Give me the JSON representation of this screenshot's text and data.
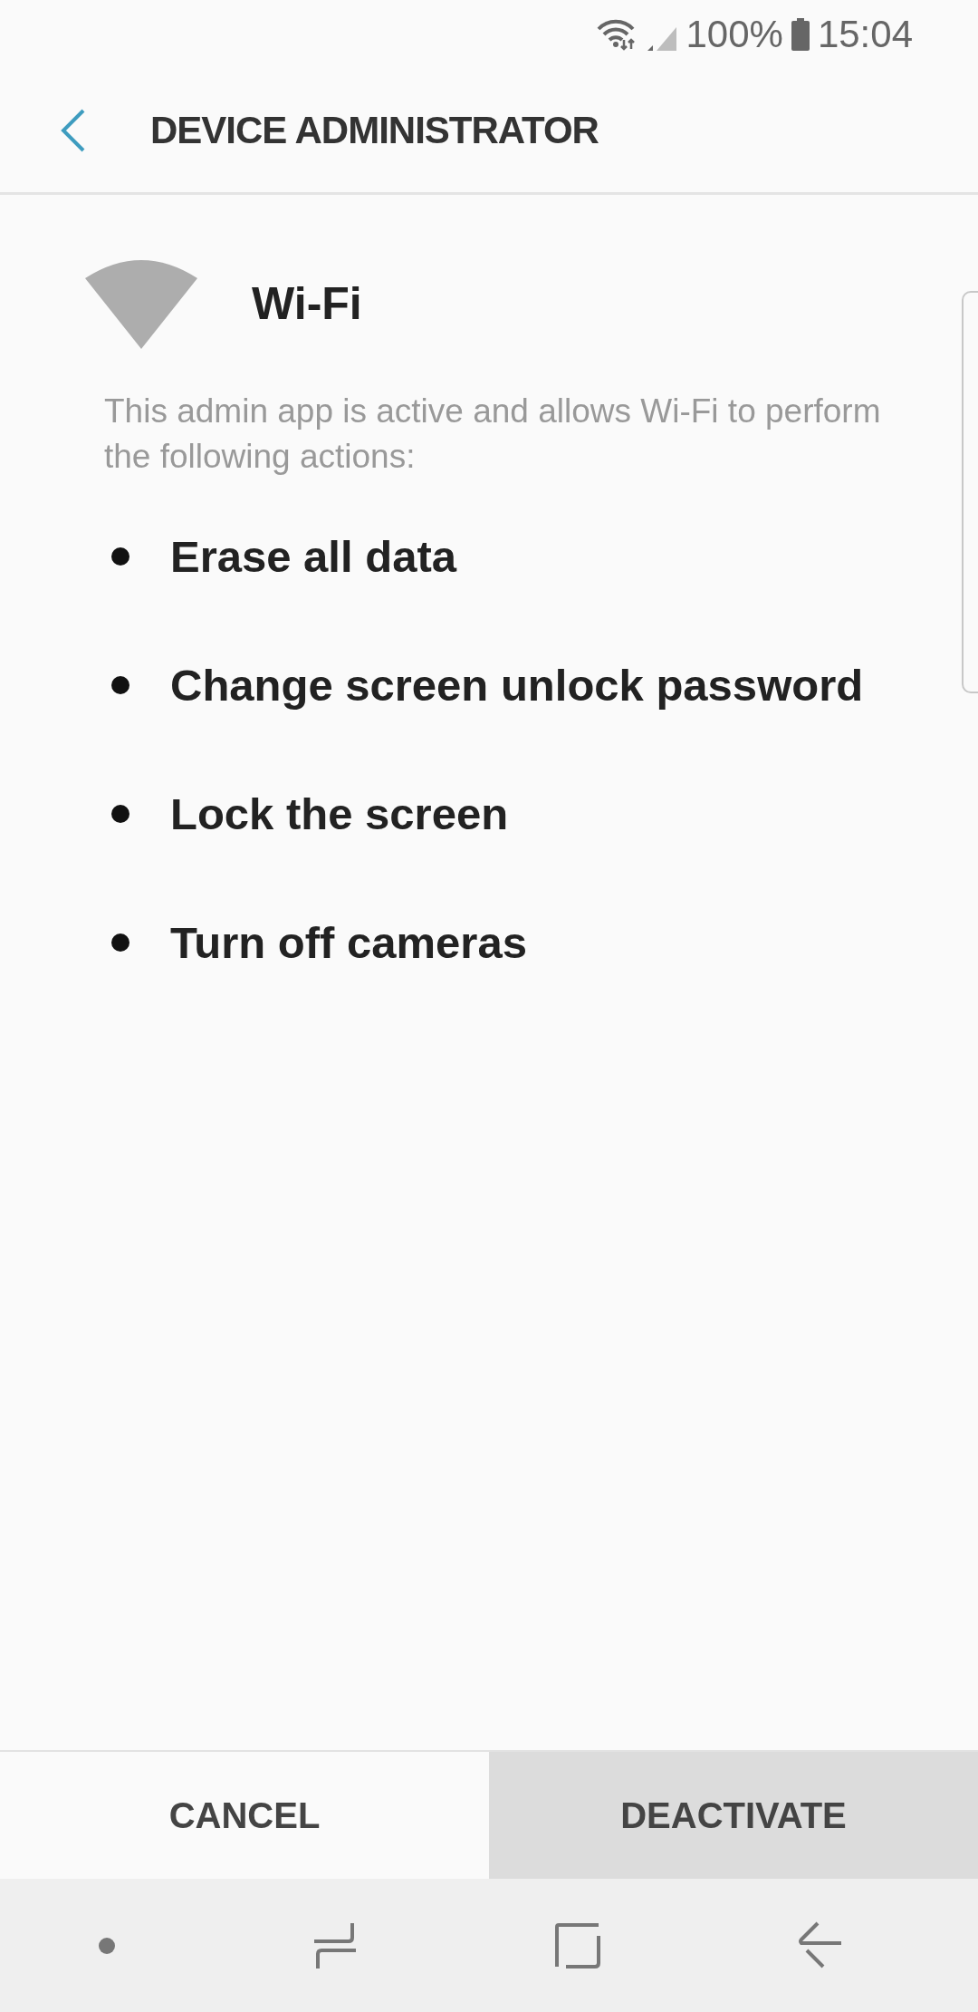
{
  "status_bar": {
    "battery": "100%",
    "time": "15:04"
  },
  "header": {
    "title": "DEVICE ADMINISTRATOR"
  },
  "app": {
    "name": "Wi-Fi",
    "description": "This admin app is active and allows Wi-Fi to perform the following actions:"
  },
  "actions": [
    "Erase all data",
    "Change screen unlock password",
    "Lock the screen",
    "Turn off cameras"
  ],
  "buttons": [
    {
      "label": "CANCEL",
      "selected": false
    },
    {
      "label": "DEACTIVATE",
      "selected": true
    }
  ]
}
